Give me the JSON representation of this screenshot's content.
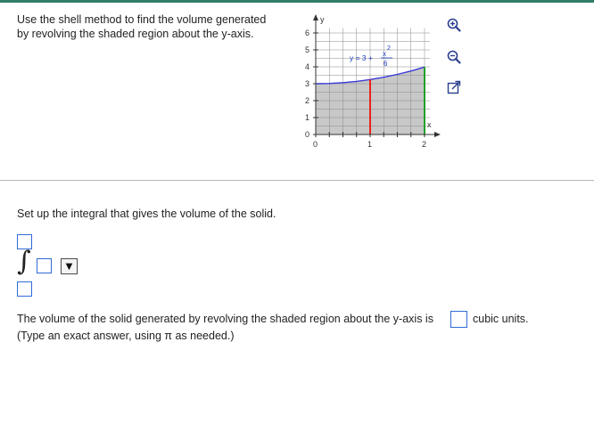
{
  "question": {
    "line1": "Use the shell method to find the volume generated",
    "line2": "by revolving the shaded region about the y-axis."
  },
  "graph": {
    "y_label": "y",
    "x_label": "x",
    "y_ticks": [
      "0",
      "1",
      "2",
      "3",
      "4",
      "5",
      "6"
    ],
    "x_ticks": [
      "0",
      "1",
      "2"
    ],
    "curve_prefix": "y = 3 +",
    "curve_numerator": "x",
    "curve_exponent": "2",
    "curve_denominator": "6",
    "colors": {
      "shade": "#c8c8c8",
      "curve": "#3a3ad8",
      "red_line": "#e8231c",
      "green_line": "#22a02a",
      "grid": "#8a8a8a"
    }
  },
  "tools": {
    "zoom_in": "zoom-in-icon",
    "zoom_out": "zoom-out-icon",
    "popout": "popout-icon"
  },
  "setup": {
    "text": "Set up the integral that gives the volume of the solid."
  },
  "integral": {
    "sign": "∫",
    "dropdown_glyph": "▼"
  },
  "answer": {
    "prompt": "The volume of the solid generated by revolving the shaded region about the y-axis is",
    "units": "cubic units.",
    "hint": "(Type an exact answer, using π as needed.)"
  }
}
